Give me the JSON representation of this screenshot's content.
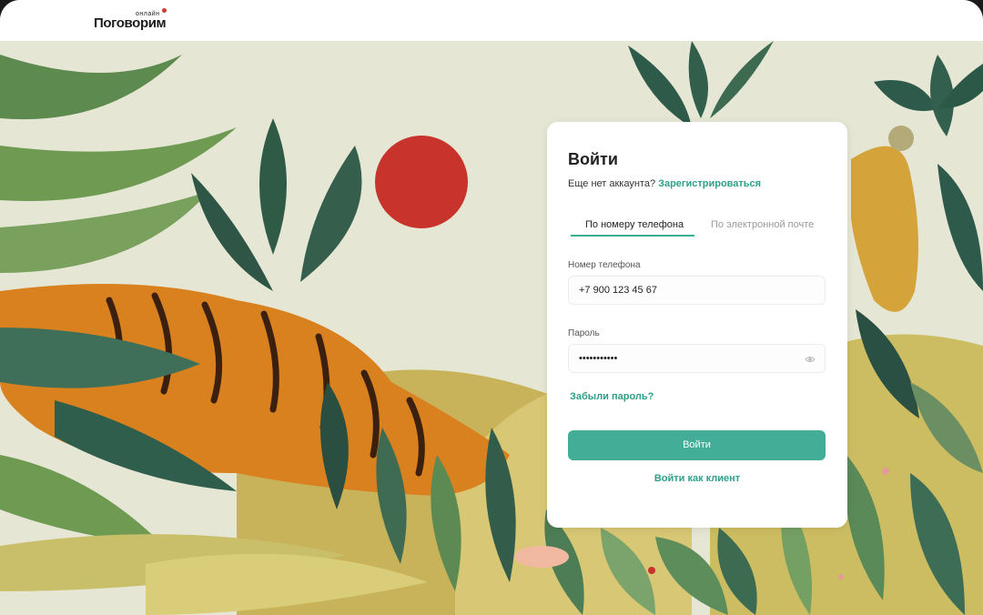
{
  "header": {
    "logo_main": "Поговорим",
    "logo_sub": "онлайн"
  },
  "login": {
    "title": "Войти",
    "no_account_text": "Еще нет аккаунта?",
    "register_link": "Зарегистрироваться",
    "tabs": [
      {
        "label": "По номеру телефона",
        "active": true
      },
      {
        "label": "По электронной почте",
        "active": false
      }
    ],
    "phone_label": "Номер телефона",
    "phone_value": "+7  900 123 45 67",
    "password_label": "Пароль",
    "password_value": "•••••••••••",
    "forgot_link": "Забыли пароль?",
    "submit_label": "Войти",
    "client_link": "Войти как клиент"
  },
  "colors": {
    "accent": "#43ad97",
    "link": "#2e9f89",
    "sun": "#c8342c",
    "background": "#e6e6d4"
  },
  "icons": [
    "eye-icon"
  ]
}
